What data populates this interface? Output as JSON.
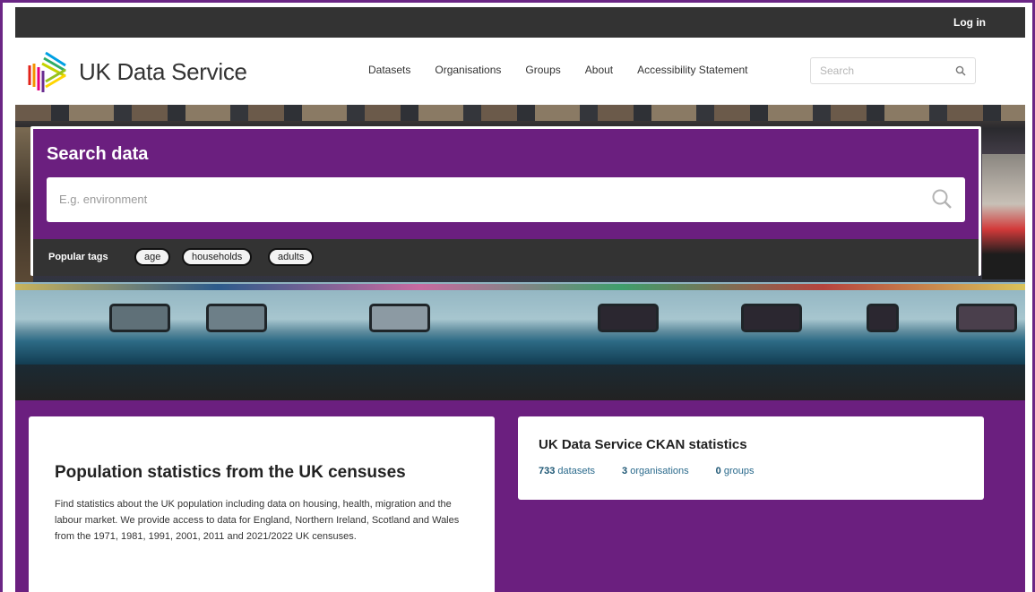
{
  "account": {
    "login_label": "Log in"
  },
  "site": {
    "name": "UK Data Service"
  },
  "nav": {
    "items": [
      {
        "label": "Datasets"
      },
      {
        "label": "Organisations"
      },
      {
        "label": "Groups"
      },
      {
        "label": "About"
      },
      {
        "label": "Accessibility Statement"
      }
    ],
    "search_placeholder": "Search"
  },
  "hero_search": {
    "title": "Search data",
    "placeholder": "E.g. environment",
    "popular_tags_label": "Popular tags",
    "tags": [
      {
        "label": "age"
      },
      {
        "label": "households"
      },
      {
        "label": "adults"
      }
    ]
  },
  "intro": {
    "heading": "Population statistics from the UK censuses",
    "body": "Find statistics about the UK population including data on housing, health, migration and the labour market. We provide access to data for England, Northern Ireland, Scotland and Wales from the 1971, 1981, 1991, 2001, 2011 and 2021/2022 UK censuses."
  },
  "stats": {
    "heading": "UK Data Service CKAN statistics",
    "items": [
      {
        "count": "733",
        "label": "datasets"
      },
      {
        "count": "3",
        "label": "organisations"
      },
      {
        "count": "0",
        "label": "groups"
      }
    ]
  },
  "colors": {
    "brand_purple": "#6b1f7f",
    "dark_bar": "#333333",
    "link_blue": "#2a6a8c"
  }
}
